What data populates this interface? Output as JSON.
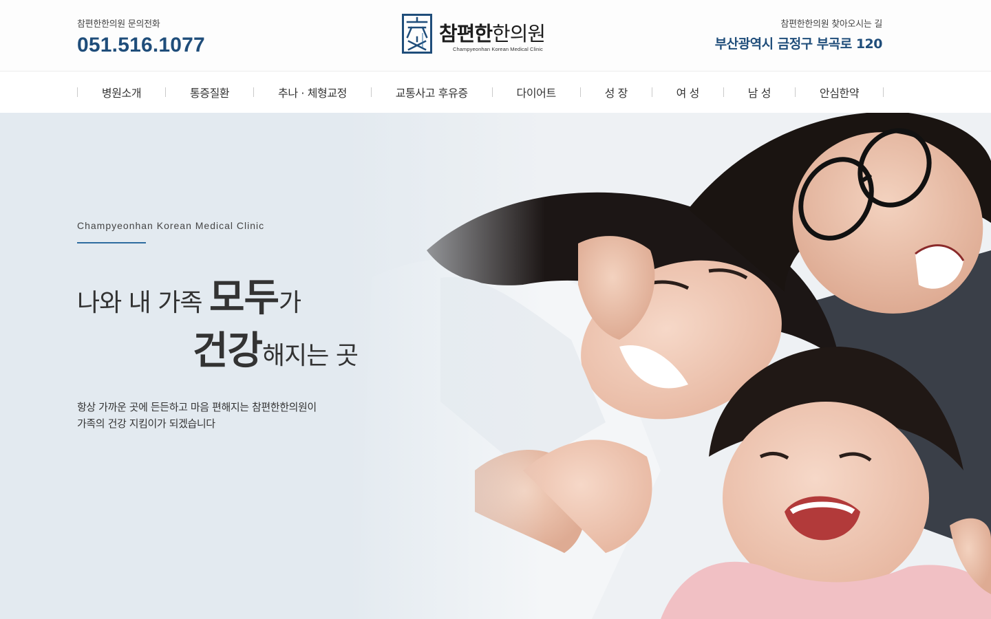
{
  "header": {
    "phone_label": "참편한한의원 문의전화",
    "phone": "051.516.1077",
    "logo_name_bold": "참편한",
    "logo_name_regular": "한의원",
    "logo_sub": "Champyeonhan Korean Medical Clinic",
    "address_label": "참편한한의원 찾아오시는 길",
    "address": "부산광역시 금정구 부곡로 120"
  },
  "nav": {
    "items": [
      {
        "label": "병원소개"
      },
      {
        "label": "통증질환"
      },
      {
        "label": "추나 · 체형교정"
      },
      {
        "label": "교통사고 후유증"
      },
      {
        "label": "다이어트"
      },
      {
        "label": "성 장"
      },
      {
        "label": "여 성"
      },
      {
        "label": "남 성"
      },
      {
        "label": "안심한약"
      }
    ]
  },
  "hero": {
    "eyebrow": "Champyeonhan Korean Medical Clinic",
    "line1_a": "나와 내 가족 ",
    "line1_big": "모두",
    "line1_b": "가",
    "line2_big": "건강",
    "line2_b": "해지는 곳",
    "desc1": "항상 가까운 곳에 든든하고 마음 편해지는 참편한한의원이",
    "desc2": "가족의 건강 지킴이가 되겠습니다"
  },
  "colors": {
    "brand": "#1f4d7a",
    "accent_line": "#2d6b9f",
    "hero_bg": "#e3eaf0"
  }
}
